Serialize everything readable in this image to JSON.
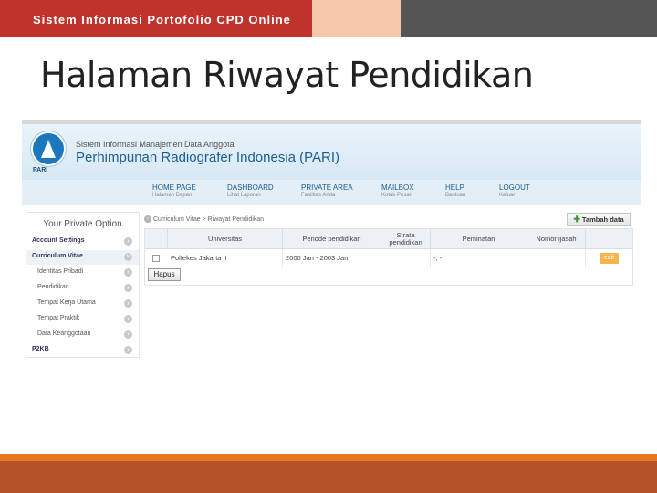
{
  "slide": {
    "header_text": "Sistem Informasi Portofolio CPD Online",
    "title": "Halaman Riwayat Pendidikan"
  },
  "site": {
    "logo_text": "PARI",
    "subtitle": "Sistem Informasi Manajemen Data Anggota",
    "org_name": "Perhimpunan Radiografer Indonesia (PARI)"
  },
  "nav": [
    {
      "label": "HOME PAGE",
      "sub": "Halaman Depan"
    },
    {
      "label": "DASHBOARD",
      "sub": "Lihat Laporan"
    },
    {
      "label": "PRIVATE AREA",
      "sub": "Fasilitas Anda"
    },
    {
      "label": "MAILBOX",
      "sub": "Kotak Pesan"
    },
    {
      "label": "HELP",
      "sub": "Bantuan"
    },
    {
      "label": "LOGOUT",
      "sub": "Keluar"
    }
  ],
  "sidebar": {
    "title": "Your Private Option",
    "items": [
      {
        "label": "Account Settings"
      },
      {
        "label": "Curriculum Vitae"
      },
      {
        "label": "Identitas Pribadi"
      },
      {
        "label": "Pendidikan"
      },
      {
        "label": "Tempat Kerja Utama"
      },
      {
        "label": "Tempat Praktik"
      },
      {
        "label": "Data Keanggotaan"
      },
      {
        "label": "P2KB"
      }
    ]
  },
  "breadcrumb": "Curriculum Vitae > Riwayat Pendidikan",
  "add_button": "Tambah data",
  "table": {
    "headers": [
      "Universitas",
      "Periode pendidikan",
      "Strata pendidikan",
      "Peminatan",
      "Nomor ijasah"
    ],
    "rows": [
      {
        "universitas": "Poltekes Jakarta II",
        "periode": "2000 Jan - 2003 Jan",
        "strata": "",
        "peminatan": "-, -",
        "nomor": "",
        "action": "edit"
      }
    ]
  },
  "delete_button": "Hapus",
  "colors": {
    "header_red": "#c0332c",
    "header_peach": "#f6c9ad",
    "header_gray": "#555555",
    "footer_orange": "#e87722",
    "footer_rust": "#b5522a",
    "brand_blue": "#1b5e93",
    "edit_orange": "#f4b54a"
  }
}
